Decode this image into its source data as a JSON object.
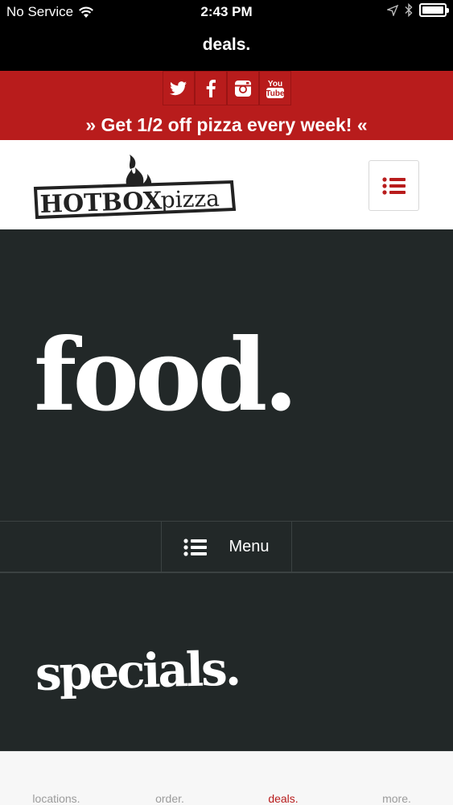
{
  "status_bar": {
    "carrier": "No Service",
    "time": "2:43 PM",
    "battery_level": 1.0
  },
  "page_title": "deals.",
  "social": {
    "items": [
      {
        "name": "twitter-icon",
        "glyph": "🐦"
      },
      {
        "name": "facebook-icon",
        "glyph": "f"
      },
      {
        "name": "instagram-icon",
        "glyph": "◘"
      },
      {
        "name": "youtube-icon",
        "line1": "You",
        "line2": "Tube"
      }
    ]
  },
  "promo_text": "» Get 1/2 off pizza every week! «",
  "logo": {
    "brand_bold": "HOTBOX",
    "brand_light": "pizza"
  },
  "food_heading": "food.",
  "menu_button_label": "Menu",
  "specials_heading": "specials.",
  "tabs": [
    {
      "label": "locations."
    },
    {
      "label": "order."
    },
    {
      "label": "deals."
    },
    {
      "label": "more."
    }
  ],
  "colors": {
    "brand_red": "#b81c1c",
    "dark_background": "#222828",
    "tab_inactive": "#9b9b9b"
  }
}
